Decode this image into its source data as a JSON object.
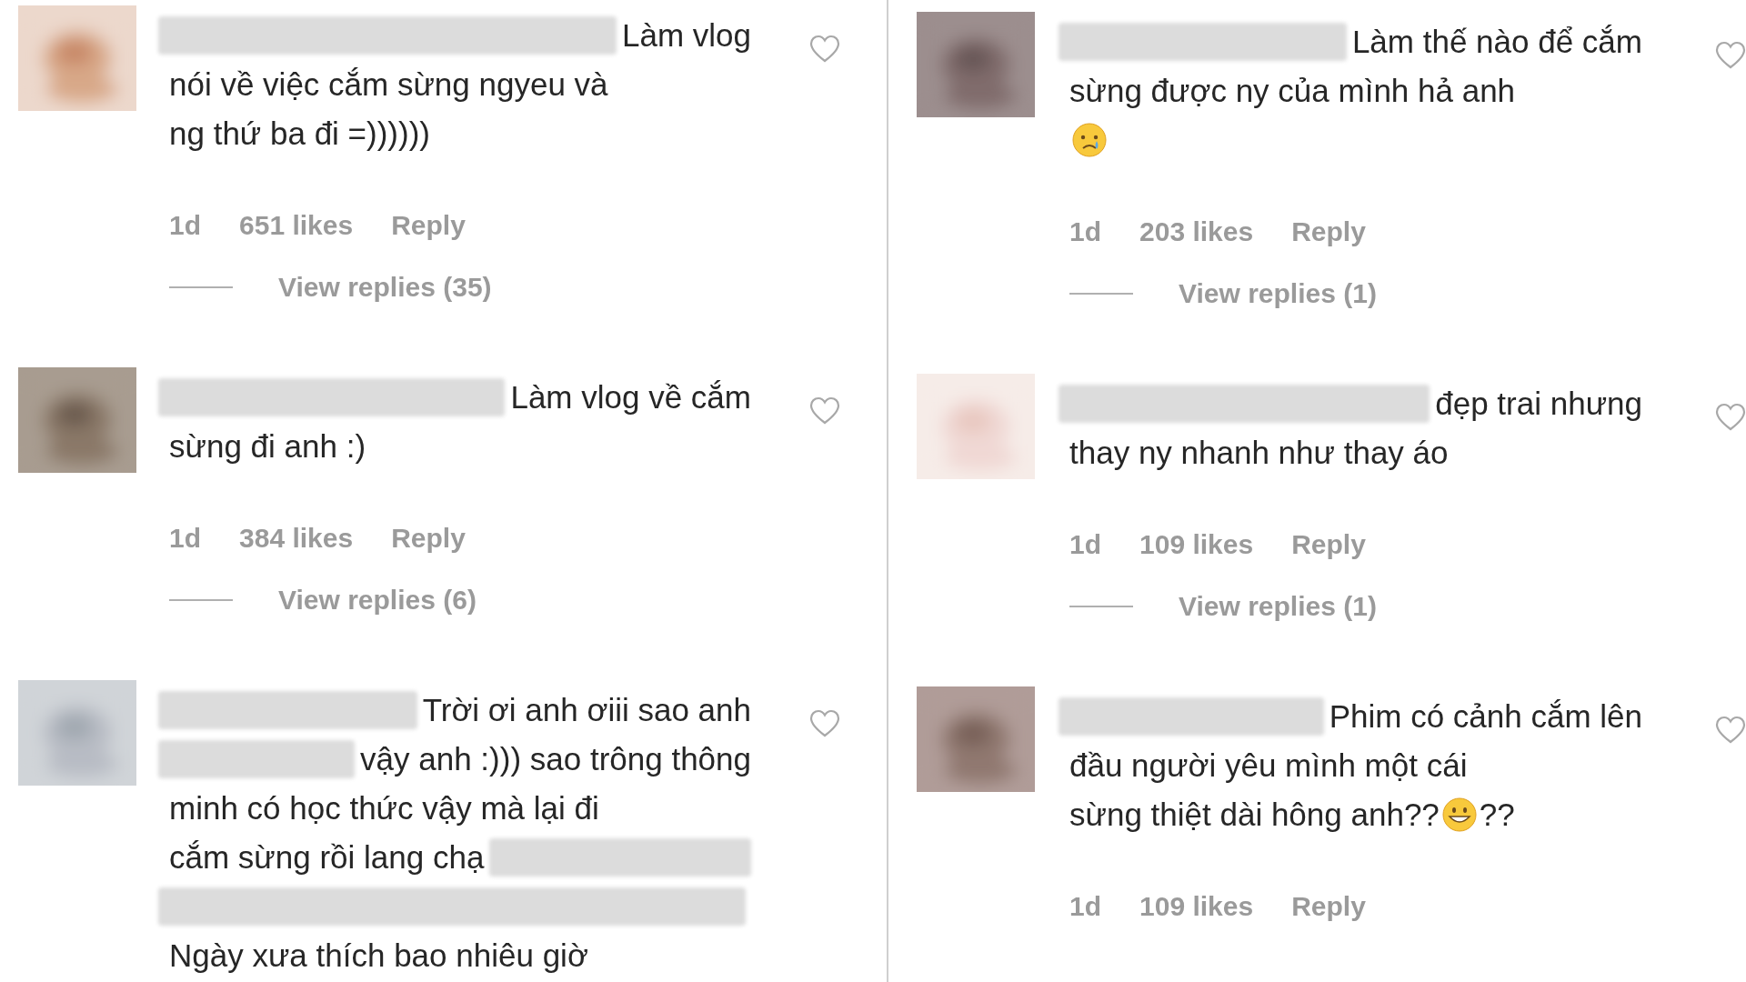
{
  "left_column": {
    "comments": [
      {
        "lines": [
          [
            {
              "kind": "blur"
            },
            {
              "kind": "text",
              "text": "Làm vlog"
            }
          ],
          [
            {
              "kind": "text",
              "text": "nói về việc cắm sừng ngyeu và"
            }
          ],
          [
            {
              "kind": "text",
              "text": "ng thứ ba đi =))))))"
            }
          ]
        ],
        "liked": false,
        "time": "1d",
        "likes": "651 likes",
        "reply": "Reply",
        "view_replies": "View replies (35)"
      },
      {
        "lines": [
          [
            {
              "kind": "blur"
            },
            {
              "kind": "text",
              "text": "Làm vlog về cắm"
            }
          ],
          [
            {
              "kind": "text",
              "text": "sừng đi anh :)"
            }
          ]
        ],
        "liked": false,
        "time": "1d",
        "likes": "384 likes",
        "reply": "Reply",
        "view_replies": "View replies (6)"
      },
      {
        "lines": [
          [
            {
              "kind": "blur"
            },
            {
              "kind": "text",
              "text": "Trời ơi anh ơiii sao anh"
            }
          ],
          [
            {
              "kind": "blur"
            },
            {
              "kind": "text",
              "text": "vậy anh :))) sao trông thông"
            }
          ],
          [
            {
              "kind": "text",
              "text": "minh có học thức vậy mà lại đi"
            }
          ],
          [
            {
              "kind": "text",
              "text": "cắm sừng rồi lang chạ"
            },
            {
              "kind": "blur"
            }
          ],
          [
            {
              "kind": "blur"
            }
          ],
          [
            {
              "kind": "text",
              "text": "Ngày xưa thích bao nhiêu giờ"
            }
          ]
        ],
        "liked": false
      }
    ]
  },
  "right_column": {
    "comments": [
      {
        "lines": [
          [
            {
              "kind": "blur"
            },
            {
              "kind": "text",
              "text": "Làm thế nào để cắm"
            }
          ],
          [
            {
              "kind": "text",
              "text": "sừng được ny của mình hả anh"
            }
          ],
          [
            {
              "kind": "crying_emoji"
            }
          ]
        ],
        "liked": false,
        "time": "1d",
        "likes": "203 likes",
        "reply": "Reply",
        "view_replies": "View replies (1)"
      },
      {
        "lines": [
          [
            {
              "kind": "blur"
            },
            {
              "kind": "text",
              "text": "đẹp trai nhưng"
            }
          ],
          [
            {
              "kind": "text",
              "text": "thay ny nhanh như thay áo"
            }
          ]
        ],
        "liked": false,
        "time": "1d",
        "likes": "109 likes",
        "reply": "Reply",
        "view_replies": "View replies (1)"
      },
      {
        "lines": [
          [
            {
              "kind": "blur"
            },
            {
              "kind": "text",
              "text": "Phim có cảnh cắm lên"
            }
          ],
          [
            {
              "kind": "text",
              "text": "đầu người yêu mình một cái"
            }
          ],
          [
            {
              "kind": "text",
              "text": "sừng thiệt dài hông anh??"
            },
            {
              "kind": "grin_emoji"
            },
            {
              "kind": "text",
              "text": "??"
            }
          ]
        ],
        "liked": false,
        "time": "1d",
        "likes": "109 likes",
        "reply": "Reply"
      }
    ]
  }
}
